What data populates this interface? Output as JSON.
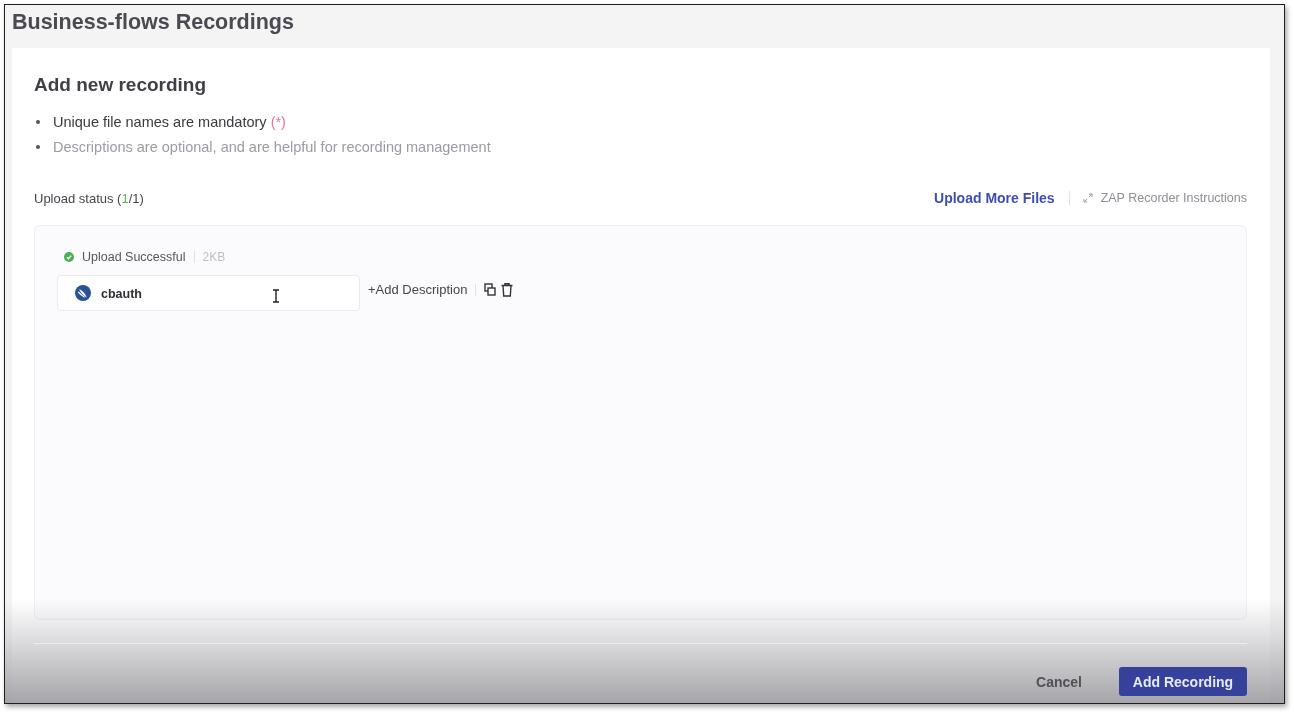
{
  "page": {
    "title": "Business-flows Recordings"
  },
  "form": {
    "heading": "Add new recording",
    "notes": [
      {
        "kind": "required",
        "parts": [
          {
            "kind": "plain",
            "text": "Unique file names are mandatory "
          },
          {
            "kind": "required",
            "text": "(*)"
          }
        ]
      },
      {
        "kind": "optional",
        "parts": [
          {
            "kind": "plain",
            "text": "Descriptions are optional, and are helpful for recording management"
          }
        ]
      }
    ],
    "upload_status": {
      "parts": [
        {
          "kind": "plain",
          "text": "Upload status ("
        },
        {
          "kind": "count",
          "text": "1"
        },
        {
          "kind": "plain",
          "text": "/1)"
        }
      ]
    },
    "links": [
      {
        "kind": "primary",
        "label": "Upload More Files"
      },
      {
        "kind": "secondary",
        "label": "ZAP Recorder Instructions"
      }
    ],
    "files": [
      {
        "succeeded": true,
        "status_label": "Upload Successful",
        "size": "2KB",
        "name": "cbauth",
        "action_label": "+Add Description"
      }
    ]
  },
  "footer": {
    "buttons": [
      {
        "kind": "text",
        "label": "Cancel"
      },
      {
        "kind": "primary",
        "label": "Add Recording"
      }
    ]
  }
}
